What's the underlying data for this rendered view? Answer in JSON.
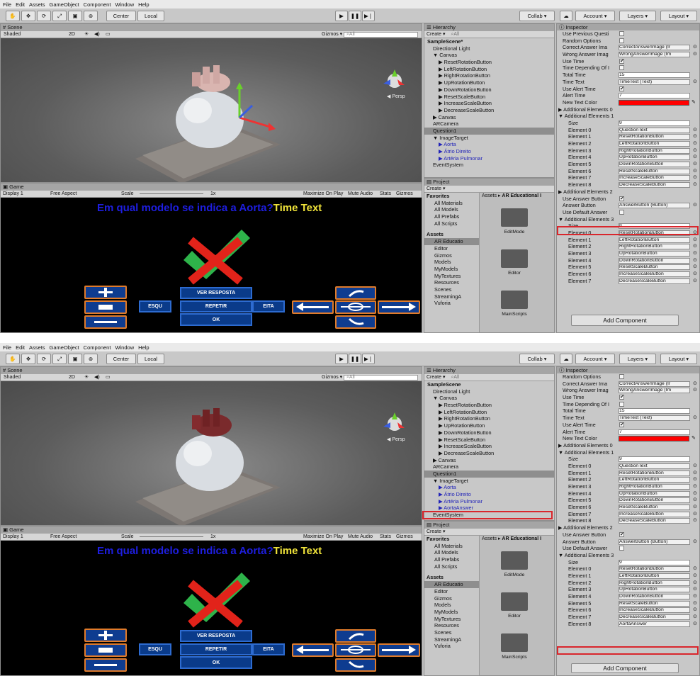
{
  "menu": [
    "File",
    "Edit",
    "Assets",
    "GameObject",
    "Component",
    "Window",
    "Help"
  ],
  "toolbar": {
    "center": "Center",
    "local": "Local",
    "collab": "Collab",
    "account": "Account",
    "layers": "Layers",
    "layout": "Layout"
  },
  "scene": {
    "tab": "Scene",
    "shading": "Shaded",
    "mode2d": "2D",
    "gizmos": "Gizmos",
    "search": "All",
    "persp": "Persp"
  },
  "game": {
    "tab": "Game",
    "display": "Display 1",
    "aspect": "Free Aspect",
    "scale_label": "Scale",
    "scale_value": "1x",
    "maximize": "Maximize On Play",
    "mute": "Mute Audio",
    "stats": "Stats",
    "gizmos": "Gizmos",
    "question": "Em qual modelo se indica a Aorta?",
    "time_text": "Time Text",
    "btn_ver": "VER RESPOSTA",
    "btn_esq": "ESQU",
    "btn_rep": "REPETIR",
    "btn_dir": "EITA",
    "btn_ok": "OK"
  },
  "hierarchy": {
    "tab": "Hierarchy",
    "create": "Create",
    "search": "All",
    "top_items": [
      {
        "label": "SampleScene*",
        "indent": 0,
        "kind": "scene"
      },
      {
        "label": "Directional Light",
        "indent": 1
      },
      {
        "label": "▼ Canvas",
        "indent": 1
      },
      {
        "label": "▶ ResetRotationButton",
        "indent": 2
      },
      {
        "label": "▶ LeftRotationButton",
        "indent": 2
      },
      {
        "label": "▶ RightRotationButton",
        "indent": 2
      },
      {
        "label": "▶ UpRotationButton",
        "indent": 2
      },
      {
        "label": "▶ DownRotationButton",
        "indent": 2
      },
      {
        "label": "▶ ResetScaleButton",
        "indent": 2
      },
      {
        "label": "▶ IncreaseScaleButton",
        "indent": 2
      },
      {
        "label": "▶ DecreaseScaleButton",
        "indent": 2
      },
      {
        "label": "▶ Canvas",
        "indent": 1
      },
      {
        "label": "ARCamera",
        "indent": 1
      },
      {
        "label": "Question1",
        "indent": 1,
        "selected": true
      },
      {
        "label": "▼ ImageTarget",
        "indent": 1
      },
      {
        "label": "▶ Aorta",
        "indent": 2,
        "blue": true
      },
      {
        "label": "▶ Átrio Direito",
        "indent": 2,
        "blue": true
      },
      {
        "label": "▶ Artéria Pulmonar",
        "indent": 2,
        "blue": true
      },
      {
        "label": "EventSystem",
        "indent": 1
      }
    ],
    "bottom_items": [
      {
        "label": "SampleScene",
        "indent": 0,
        "kind": "scene"
      },
      {
        "label": "Directional Light",
        "indent": 1
      },
      {
        "label": "▼ Canvas",
        "indent": 1
      },
      {
        "label": "▶ ResetRotationButton",
        "indent": 2
      },
      {
        "label": "▶ LeftRotationButton",
        "indent": 2
      },
      {
        "label": "▶ RightRotationButton",
        "indent": 2
      },
      {
        "label": "▶ UpRotationButton",
        "indent": 2
      },
      {
        "label": "▶ DownRotationButton",
        "indent": 2
      },
      {
        "label": "▶ ResetScaleButton",
        "indent": 2
      },
      {
        "label": "▶ IncreaseScaleButton",
        "indent": 2
      },
      {
        "label": "▶ DecreaseScaleButton",
        "indent": 2
      },
      {
        "label": "▶ Canvas",
        "indent": 1
      },
      {
        "label": "ARCamera",
        "indent": 1
      },
      {
        "label": "Question1",
        "indent": 1,
        "selected": true
      },
      {
        "label": "▼ ImageTarget",
        "indent": 1
      },
      {
        "label": "▶ Aorta",
        "indent": 2,
        "blue": true
      },
      {
        "label": "▶ Átrio Direito",
        "indent": 2,
        "blue": true
      },
      {
        "label": "▶ Artéria Pulmonar",
        "indent": 2,
        "blue": true
      },
      {
        "label": "▶ AortaAnswer",
        "indent": 2,
        "blue": true,
        "highlight": true
      },
      {
        "label": "EventSystem",
        "indent": 1
      }
    ]
  },
  "project": {
    "tab": "Project",
    "create": "Create",
    "breadcrumb_root": "Assets",
    "breadcrumb_top": "AR Educational I",
    "breadcrumb_bottom": "AR Educational I",
    "favorites": [
      "Favorites",
      "All Materials",
      "All Models",
      "All Prefabs",
      "All Scripts"
    ],
    "assets": [
      "Assets",
      "AR Educatio",
      "Editor",
      "Gizmos",
      "Models",
      "MyModels",
      "MyTextures",
      "Resources",
      "Scenes",
      "StreamingA",
      "Vuforia"
    ],
    "folders": [
      "EditMode",
      "Editor",
      "MainScripts"
    ]
  },
  "inspector": {
    "tab": "Inspector",
    "add_component": "Add Component",
    "top_rows": [
      {
        "l": "Use Previous Questi",
        "t": "chk",
        "v": ""
      },
      {
        "l": "Random Options",
        "t": "chk",
        "v": ""
      },
      {
        "l": "Correct Answer Ima",
        "t": "ref",
        "v": "CorrectAnswerImage (Ir"
      },
      {
        "l": "Wrong Answer Imag",
        "t": "ref",
        "v": "WrongAnswerImage (Im"
      },
      {
        "l": "Use Time",
        "t": "chk",
        "v": "✔"
      },
      {
        "l": "Time Depending Of I",
        "t": "chk",
        "v": ""
      },
      {
        "l": "Total Time",
        "t": "text",
        "v": "15"
      },
      {
        "l": "Time Text",
        "t": "ref",
        "v": "TimeText (Text)"
      },
      {
        "l": "Use Alert Time",
        "t": "chk",
        "v": "✔"
      },
      {
        "l": "Alert Time",
        "t": "text",
        "v": "7"
      },
      {
        "l": "New Text Color",
        "t": "color",
        "v": ""
      },
      {
        "l": "▶ Additional Elements 0",
        "t": "head",
        "v": ""
      },
      {
        "l": "▼ Additional Elements 1",
        "t": "head",
        "v": ""
      },
      {
        "l": "Size",
        "t": "text",
        "v": "9"
      },
      {
        "l": "Element 0",
        "t": "ref",
        "v": "QuestionText"
      },
      {
        "l": "Element 1",
        "t": "ref",
        "v": "ResetRotationButton"
      },
      {
        "l": "Element 2",
        "t": "ref",
        "v": "LeftRotationButton"
      },
      {
        "l": "Element 3",
        "t": "ref",
        "v": "RightRotationButton"
      },
      {
        "l": "Element 4",
        "t": "ref",
        "v": "UpRotationButton"
      },
      {
        "l": "Element 5",
        "t": "ref",
        "v": "DownRotationButton"
      },
      {
        "l": "Element 6",
        "t": "ref",
        "v": "ResetScaleButton"
      },
      {
        "l": "Element 7",
        "t": "ref",
        "v": "IncreaseScaleButton"
      },
      {
        "l": "Element 8",
        "t": "ref",
        "v": "DecreaseScaleButton"
      },
      {
        "l": "▶ Additional Elements 2",
        "t": "head",
        "v": ""
      },
      {
        "l": "Use Answer Button",
        "t": "chk",
        "v": "✔"
      },
      {
        "l": "Answer Button",
        "t": "ref",
        "v": "AnswerButton (Button)"
      },
      {
        "l": "Use Default Answer",
        "t": "chk",
        "v": "",
        "highlight": true
      },
      {
        "l": "▼ Additional Elements 3",
        "t": "head",
        "v": ""
      },
      {
        "l": "Size",
        "t": "text",
        "v": "8"
      },
      {
        "l": "Element 0",
        "t": "ref",
        "v": "ResetRotationButton"
      },
      {
        "l": "Element 1",
        "t": "ref",
        "v": "LeftRotationButton"
      },
      {
        "l": "Element 2",
        "t": "ref",
        "v": "RightRotationButton"
      },
      {
        "l": "Element 3",
        "t": "ref",
        "v": "UpRotationButton"
      },
      {
        "l": "Element 4",
        "t": "ref",
        "v": "DownRotationButton"
      },
      {
        "l": "Element 5",
        "t": "ref",
        "v": "ResetScaleButton"
      },
      {
        "l": "Element 6",
        "t": "ref",
        "v": "IncreaseScaleButton"
      },
      {
        "l": "Element 7",
        "t": "ref",
        "v": "DecreaseScaleButton"
      }
    ],
    "bottom_rows": [
      {
        "l": "Random Options",
        "t": "chk",
        "v": ""
      },
      {
        "l": "Correct Answer Ima",
        "t": "ref",
        "v": "CorrectAnswerImage (Ir"
      },
      {
        "l": "Wrong Answer Imag",
        "t": "ref",
        "v": "WrongAnswerImage (Im"
      },
      {
        "l": "Use Time",
        "t": "chk",
        "v": "✔"
      },
      {
        "l": "Time Depending Of I",
        "t": "chk",
        "v": ""
      },
      {
        "l": "Total Time",
        "t": "text",
        "v": "15"
      },
      {
        "l": "Time Text",
        "t": "ref",
        "v": "TimeText (Text)"
      },
      {
        "l": "Use Alert Time",
        "t": "chk",
        "v": "✔"
      },
      {
        "l": "Alert Time",
        "t": "text",
        "v": "7"
      },
      {
        "l": "New Text Color",
        "t": "color",
        "v": ""
      },
      {
        "l": "▶ Additional Elements 0",
        "t": "head",
        "v": ""
      },
      {
        "l": "▼ Additional Elements 1",
        "t": "head",
        "v": ""
      },
      {
        "l": "Size",
        "t": "text",
        "v": "9"
      },
      {
        "l": "Element 0",
        "t": "ref",
        "v": "QuestionText"
      },
      {
        "l": "Element 1",
        "t": "ref",
        "v": "ResetRotationButton"
      },
      {
        "l": "Element 2",
        "t": "ref",
        "v": "LeftRotationButton"
      },
      {
        "l": "Element 3",
        "t": "ref",
        "v": "RightRotationButton"
      },
      {
        "l": "Element 4",
        "t": "ref",
        "v": "UpRotationButton"
      },
      {
        "l": "Element 5",
        "t": "ref",
        "v": "DownRotationButton"
      },
      {
        "l": "Element 6",
        "t": "ref",
        "v": "ResetScaleButton"
      },
      {
        "l": "Element 7",
        "t": "ref",
        "v": "IncreaseScaleButton"
      },
      {
        "l": "Element 8",
        "t": "ref",
        "v": "DecreaseScaleButton"
      },
      {
        "l": "▶ Additional Elements 2",
        "t": "head",
        "v": ""
      },
      {
        "l": "Use Answer Button",
        "t": "chk",
        "v": "✔"
      },
      {
        "l": "Answer Button",
        "t": "ref",
        "v": "AnswerButton (Button)"
      },
      {
        "l": "Use Default Answer",
        "t": "chk",
        "v": ""
      },
      {
        "l": "▼ Additional Elements 3",
        "t": "head",
        "v": ""
      },
      {
        "l": "Size",
        "t": "text",
        "v": "9"
      },
      {
        "l": "Element 0",
        "t": "ref",
        "v": "ResetRotationButton"
      },
      {
        "l": "Element 1",
        "t": "ref",
        "v": "LeftRotationButton"
      },
      {
        "l": "Element 2",
        "t": "ref",
        "v": "RightRotationButton"
      },
      {
        "l": "Element 3",
        "t": "ref",
        "v": "UpRotationButton"
      },
      {
        "l": "Element 4",
        "t": "ref",
        "v": "DownRotationButton"
      },
      {
        "l": "Element 5",
        "t": "ref",
        "v": "ResetScaleButton"
      },
      {
        "l": "Element 6",
        "t": "ref",
        "v": "IncreaseScaleButton"
      },
      {
        "l": "Element 7",
        "t": "ref",
        "v": "DecreaseScaleButton"
      },
      {
        "l": "Element 8",
        "t": "ref",
        "v": "AortaAnswer",
        "highlight": true
      }
    ]
  },
  "colors": {
    "highlight_red": "#d9262c",
    "question_blue": "#1e1ee0",
    "time_yellow": "#f0e33a",
    "new_text_color": "#ff0000",
    "button_blue": "#0e3c90",
    "button_border": "#e07b2a"
  }
}
